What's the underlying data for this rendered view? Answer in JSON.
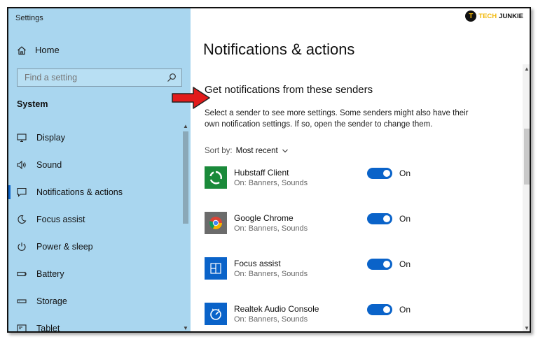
{
  "window": {
    "title": "Settings",
    "minimize": "—",
    "maximize": "☐",
    "close": "✕"
  },
  "logo": {
    "badge": "T",
    "text1": "TECH",
    "text2": "JUNKIE"
  },
  "sidebar": {
    "home_label": "Home",
    "search_placeholder": "Find a setting",
    "section_label": "System",
    "items": [
      {
        "label": "Display",
        "icon": "monitor-icon"
      },
      {
        "label": "Sound",
        "icon": "speaker-icon"
      },
      {
        "label": "Notifications & actions",
        "icon": "notification-icon",
        "active": true
      },
      {
        "label": "Focus assist",
        "icon": "moon-icon"
      },
      {
        "label": "Power & sleep",
        "icon": "power-icon"
      },
      {
        "label": "Battery",
        "icon": "battery-icon"
      },
      {
        "label": "Storage",
        "icon": "storage-icon"
      },
      {
        "label": "Tablet",
        "icon": "tablet-icon"
      }
    ]
  },
  "main": {
    "title": "Notifications & actions",
    "subtitle": "Get notifications from these senders",
    "description": "Select a sender to see more settings. Some senders might also have their own notification settings. If so, open the sender to change them.",
    "sort_label": "Sort by:",
    "sort_value": "Most recent",
    "senders": [
      {
        "name": "Hubstaff Client",
        "status": "On: Banners, Sounds",
        "toggle": "On",
        "icon": "hubstaff-icon"
      },
      {
        "name": "Google Chrome",
        "status": "On: Banners, Sounds",
        "toggle": "On",
        "icon": "chrome-icon"
      },
      {
        "name": "Focus assist",
        "status": "On: Banners, Sounds",
        "toggle": "On",
        "icon": "focus-assist-icon"
      },
      {
        "name": "Realtek Audio Console",
        "status": "On: Banners, Sounds",
        "toggle": "On",
        "icon": "realtek-icon"
      }
    ]
  },
  "colors": {
    "sidebar_bg": "#a9d6ef",
    "accent": "#0a63c9",
    "arrow": "#e21b1b"
  }
}
